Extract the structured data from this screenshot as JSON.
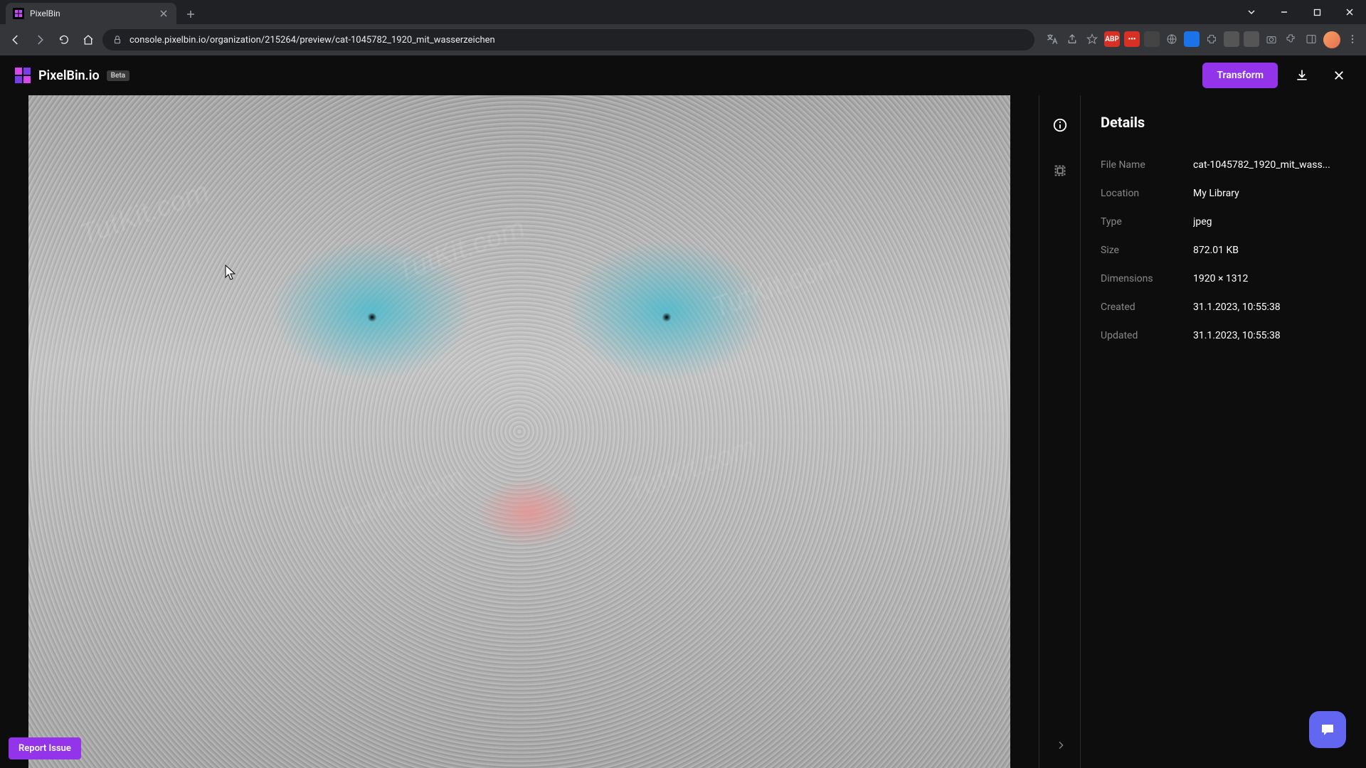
{
  "browser": {
    "tab_title": "PixelBin",
    "url": "console.pixelbin.io/organization/215264/preview/cat-1045782_1920_mit_wasserzeichen"
  },
  "header": {
    "brand": "PixelBin.io",
    "beta": "Beta",
    "transform_label": "Transform"
  },
  "details": {
    "title": "Details",
    "rows": [
      {
        "label": "File Name",
        "value": "cat-1045782_1920_mit_wass..."
      },
      {
        "label": "Location",
        "value": "My Library"
      },
      {
        "label": "Type",
        "value": "jpeg"
      },
      {
        "label": "Size",
        "value": "872.01 KB"
      },
      {
        "label": "Dimensions",
        "value": "1920 × 1312"
      },
      {
        "label": "Created",
        "value": "31.1.2023, 10:55:38"
      },
      {
        "label": "Updated",
        "value": "31.1.2023, 10:55:38"
      }
    ]
  },
  "report_issue": "Report Issue",
  "watermark": "TutKit.com"
}
